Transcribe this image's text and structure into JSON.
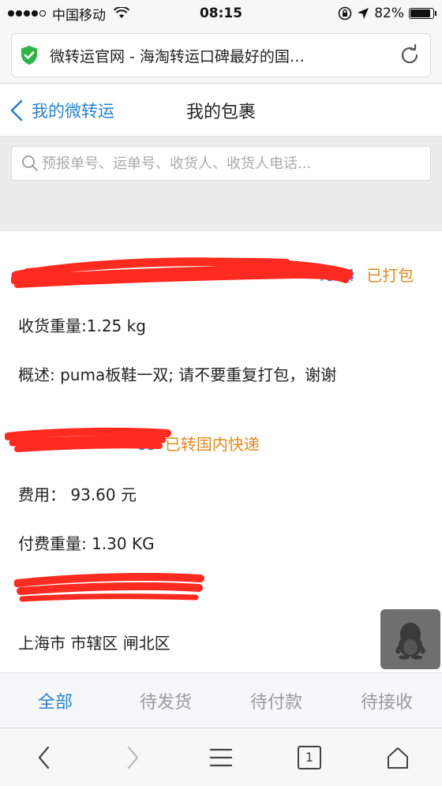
{
  "status_bar": {
    "carrier": "中国移动",
    "time": "08:15",
    "battery": "82%",
    "battery_level": 0.82
  },
  "browser": {
    "page_title": "微转运官网 - 海淘转运口碑最好的国…"
  },
  "nav": {
    "back_label": "我的微转运",
    "title": "我的包裹"
  },
  "search": {
    "placeholder": "预报单号、运单号、收货人、收货人电话..."
  },
  "parcels": [
    {
      "id_visible_tail": "4054",
      "status": "已打包",
      "weight_line": "收货重量:1.25 kg",
      "description_line": "概述: puma板鞋一双; 请不要重复打包，谢谢"
    },
    {
      "id_visible_tail": "69",
      "status": "已转国内快递",
      "fee_line": "费用：  93.60 元",
      "paid_weight_line": "付费重量: 1.30 KG",
      "address_line": "上海市 市辖区 闸北区"
    }
  ],
  "tabs": [
    {
      "label": "全部",
      "active": true
    },
    {
      "label": "待发货",
      "active": false
    },
    {
      "label": "待付款",
      "active": false
    },
    {
      "label": "待接收",
      "active": false
    }
  ],
  "toolbar": {
    "tab_count": "1"
  },
  "colors": {
    "accent_blue": "#2a82c9",
    "status_orange": "#e08a1e",
    "redaction_red": "#ff2a20"
  }
}
